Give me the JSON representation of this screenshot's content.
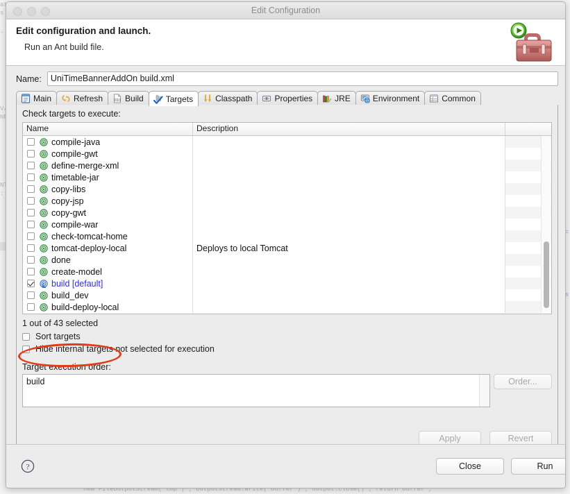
{
  "window": {
    "title": "Edit Configuration",
    "traffic_lights": [
      "close-button",
      "minimize-button",
      "zoom-button"
    ]
  },
  "banner": {
    "heading": "Edit configuration and launch.",
    "subheading": "Run an Ant build file.",
    "icon": "ant-toolbox-icon"
  },
  "name_field": {
    "label": "Name:",
    "value": "UniTimeBannerAddOn build.xml",
    "placeholder": ""
  },
  "tabs": [
    {
      "label": "Main",
      "icon": "main-document-icon",
      "active": false
    },
    {
      "label": "Refresh",
      "icon": "refresh-arrows-icon",
      "active": false
    },
    {
      "label": "Build",
      "icon": "build-010-icon",
      "active": false
    },
    {
      "label": "Targets",
      "icon": "targets-check-icon",
      "active": true
    },
    {
      "label": "Classpath",
      "icon": "classpath-arrows-icon",
      "active": false
    },
    {
      "label": "Properties",
      "icon": "properties-icon",
      "active": false
    },
    {
      "label": "JRE",
      "icon": "jre-books-icon",
      "active": false
    },
    {
      "label": "Environment",
      "icon": "environment-icon",
      "active": false
    },
    {
      "label": "Common",
      "icon": "common-window-icon",
      "active": false
    }
  ],
  "targets_panel": {
    "instruction": "Check targets to execute:",
    "columns": [
      "Name",
      "Description",
      ""
    ],
    "rows": [
      {
        "name": "compile-java",
        "description": "",
        "checked": false,
        "default": false
      },
      {
        "name": "compile-gwt",
        "description": "",
        "checked": false,
        "default": false
      },
      {
        "name": "define-merge-xml",
        "description": "",
        "checked": false,
        "default": false
      },
      {
        "name": "timetable-jar",
        "description": "",
        "checked": false,
        "default": false
      },
      {
        "name": "copy-libs",
        "description": "",
        "checked": false,
        "default": false
      },
      {
        "name": "copy-jsp",
        "description": "",
        "checked": false,
        "default": false
      },
      {
        "name": "copy-gwt",
        "description": "",
        "checked": false,
        "default": false
      },
      {
        "name": "compile-war",
        "description": "",
        "checked": false,
        "default": false
      },
      {
        "name": "check-tomcat-home",
        "description": "",
        "checked": false,
        "default": false
      },
      {
        "name": "tomcat-deploy-local",
        "description": "Deploys to local Tomcat",
        "checked": false,
        "default": false
      },
      {
        "name": "done",
        "description": "",
        "checked": false,
        "default": false
      },
      {
        "name": "create-model",
        "description": "",
        "checked": false,
        "default": false
      },
      {
        "name": "build [default]",
        "description": "",
        "checked": true,
        "default": true
      },
      {
        "name": "build_dev",
        "description": "",
        "checked": false,
        "default": false
      },
      {
        "name": "build-deploy-local",
        "description": "",
        "checked": false,
        "default": false
      }
    ],
    "selected_count_text": "1 out of 43 selected",
    "sort_targets": {
      "label": "Sort targets",
      "checked": false
    },
    "hide_internal": {
      "label": "Hide internal targets not selected for execution",
      "checked": false
    },
    "execution_order_label": "Target execution order:",
    "execution_order_value": "build",
    "order_button": {
      "label": "Order...",
      "enabled": false
    }
  },
  "panel_buttons": {
    "apply": {
      "label": "Apply",
      "enabled": false
    },
    "revert": {
      "label": "Revert",
      "enabled": false
    }
  },
  "footer": {
    "help_icon": "help-question-icon",
    "close": {
      "label": "Close"
    },
    "run": {
      "label": "Run"
    }
  },
  "annotation": {
    "type": "red-ellipse-highlight",
    "target": "build [default]",
    "color": "#e23b18"
  },
  "colors": {
    "dialog_bg": "#ececec",
    "list_bg": "#ffffff",
    "stripe": "#f4f4f4",
    "default_target_text": "#2f30c8",
    "target_icon_green": "#2e8b3d",
    "default_icon_blue": "#3f77c8",
    "annotation_red": "#e23b18"
  }
}
